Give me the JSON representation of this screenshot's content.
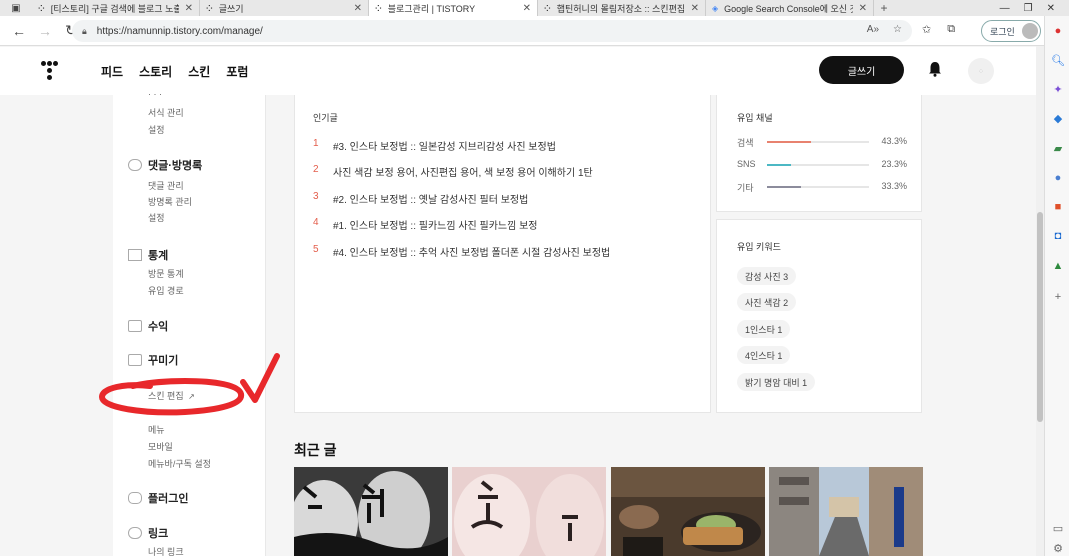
{
  "browser": {
    "tabs": [
      {
        "label": "[티스토리] 구글 검색에 블로그 노출",
        "active": false
      },
      {
        "label": "글쓰기",
        "active": false
      },
      {
        "label": "블로그관리 | TISTORY",
        "active": true
      },
      {
        "label": "햅틴허니의 몰림저장소 :: 스킨편집",
        "active": false
      },
      {
        "label": "Google Search Console에 오신 것",
        "active": false
      }
    ],
    "url": "https://namunnip.tistory.com/manage/",
    "login_label": "로그인"
  },
  "header": {
    "nav": [
      "피드",
      "스토리",
      "스킨",
      "포럼"
    ],
    "write_label": "글쓰기"
  },
  "sidebar": {
    "top_items": [
      "서식 관리",
      "설정"
    ],
    "sections": [
      {
        "title": "댓글·방명록",
        "items": [
          "댓글 관리",
          "방명록 관리",
          "설정"
        ]
      },
      {
        "title": "통계",
        "items": [
          "방문 통계",
          "유입 경로"
        ]
      },
      {
        "title": "수익",
        "items": []
      },
      {
        "title": "꾸미기",
        "items": [
          "스킨 편집",
          "",
          "메뉴",
          "모바일",
          "메뉴바/구독 설정"
        ]
      },
      {
        "title": "플러그인",
        "items": []
      },
      {
        "title": "링크",
        "items": [
          "나의 링크"
        ]
      }
    ]
  },
  "popular": {
    "title": "인기글",
    "items": [
      {
        "rank": "1",
        "title": "#3. 인스타 보정법 :: 일본감성 지브리감성 사진 보정법"
      },
      {
        "rank": "2",
        "title": "사진 색감 보정 용어, 사진편집 용어, 색 보정 용어 이해하기 1탄"
      },
      {
        "rank": "3",
        "title": "#2. 인스타 보정법 :: 옛날 감성사진 필터 보정법"
      },
      {
        "rank": "4",
        "title": "#1. 인스타 보정법 :: 필카느낌 사진 필카느낌 보정"
      },
      {
        "rank": "5",
        "title": "#4. 인스타 보정법 :: 추억 사진 보정법 폴더폰 시절 감성사진 보정법"
      }
    ]
  },
  "channels": {
    "title": "유입 채널",
    "rows": [
      {
        "label": "검색",
        "value": 43.3,
        "pct": "43.3%",
        "color": "#e8826f"
      },
      {
        "label": "SNS",
        "value": 23.3,
        "pct": "23.3%",
        "color": "#4cb8c4"
      },
      {
        "label": "기타",
        "value": 33.3,
        "pct": "33.3%",
        "color": "#8c8c9c"
      }
    ]
  },
  "keywords": {
    "title": "유입 키워드",
    "items": [
      "감성 사진  3",
      "사진 색감  2",
      "1인스타  1",
      "4인스타  1",
      "밝기 명암 대비  1"
    ]
  },
  "recent": {
    "title": "최근 글"
  },
  "colors": {
    "accent": "#e35d4b",
    "annotation": "#e8282b"
  }
}
